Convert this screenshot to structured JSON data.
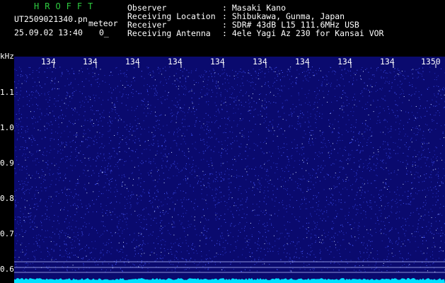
{
  "header": {
    "brand": "HROFFT",
    "filename": "UT2509021340.pn",
    "mode": "meteor",
    "datetime": "25.09.02 13:40",
    "counter": "0_",
    "fields": [
      {
        "label": "Observer",
        "value": ": Masaki Kano"
      },
      {
        "label": "Receiving Location",
        "value": ": Shibukawa, Gunma, Japan"
      },
      {
        "label": "Receiver",
        "value": ": SDR# 43dB L15 111.6MHz USB"
      },
      {
        "label": "Receiving Antenna",
        "value": ": 4ele Yagi Az 230 for Kansai VOR"
      }
    ]
  },
  "y_axis": {
    "unit": "kHz",
    "ticks": [
      "1.1",
      "1.0",
      "0.9",
      "0.8",
      "0.7",
      "0.6"
    ]
  },
  "x_axis": {
    "ticks": [
      "134",
      "134",
      "134",
      "134",
      "134",
      "134",
      "134",
      "134",
      "134",
      "1350"
    ]
  },
  "colors": {
    "background": "#0a0a6e",
    "noise": "#4a5cff",
    "signal": "#00e0ff",
    "brand": "#2ecc40"
  }
}
